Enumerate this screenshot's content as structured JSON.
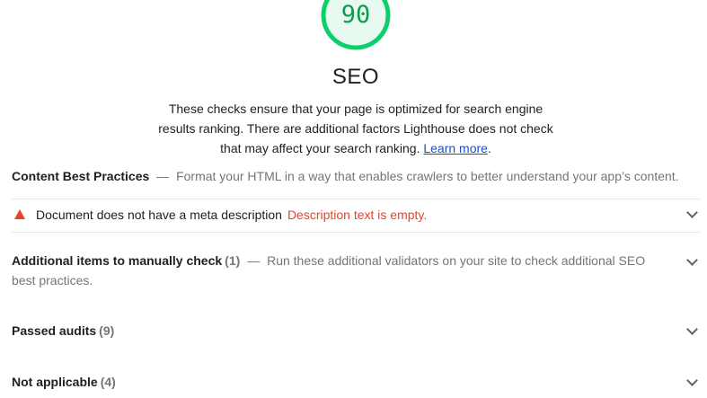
{
  "gauge": {
    "score": "90",
    "fraction": 0.9,
    "color": "#0cce6b",
    "fill": "#e8f9ef"
  },
  "category": {
    "title": "SEO",
    "description": "These checks ensure that your page is optimized for search engine results ranking. There are additional factors Lighthouse does not check that may affect your search ranking.",
    "link_label": "Learn more",
    "link_suffix": "."
  },
  "groups": {
    "content": {
      "title": "Content Best Practices",
      "separator": "—",
      "description": "Format your HTML in a way that enables crawlers to better understand your app’s content."
    },
    "audit": {
      "icon": "warning-triangle-icon",
      "title": "Document does not have a meta description",
      "display": "Description text is empty.",
      "status_color": "#e8432a"
    },
    "manual": {
      "title": "Additional items to manually check",
      "count": "(1)",
      "separator": "—",
      "description": "Run these additional validators on your site to check additional SEO best practices."
    },
    "passed": {
      "title": "Passed audits",
      "count": "(9)"
    },
    "not_applicable": {
      "title": "Not applicable",
      "count": "(4)"
    }
  }
}
